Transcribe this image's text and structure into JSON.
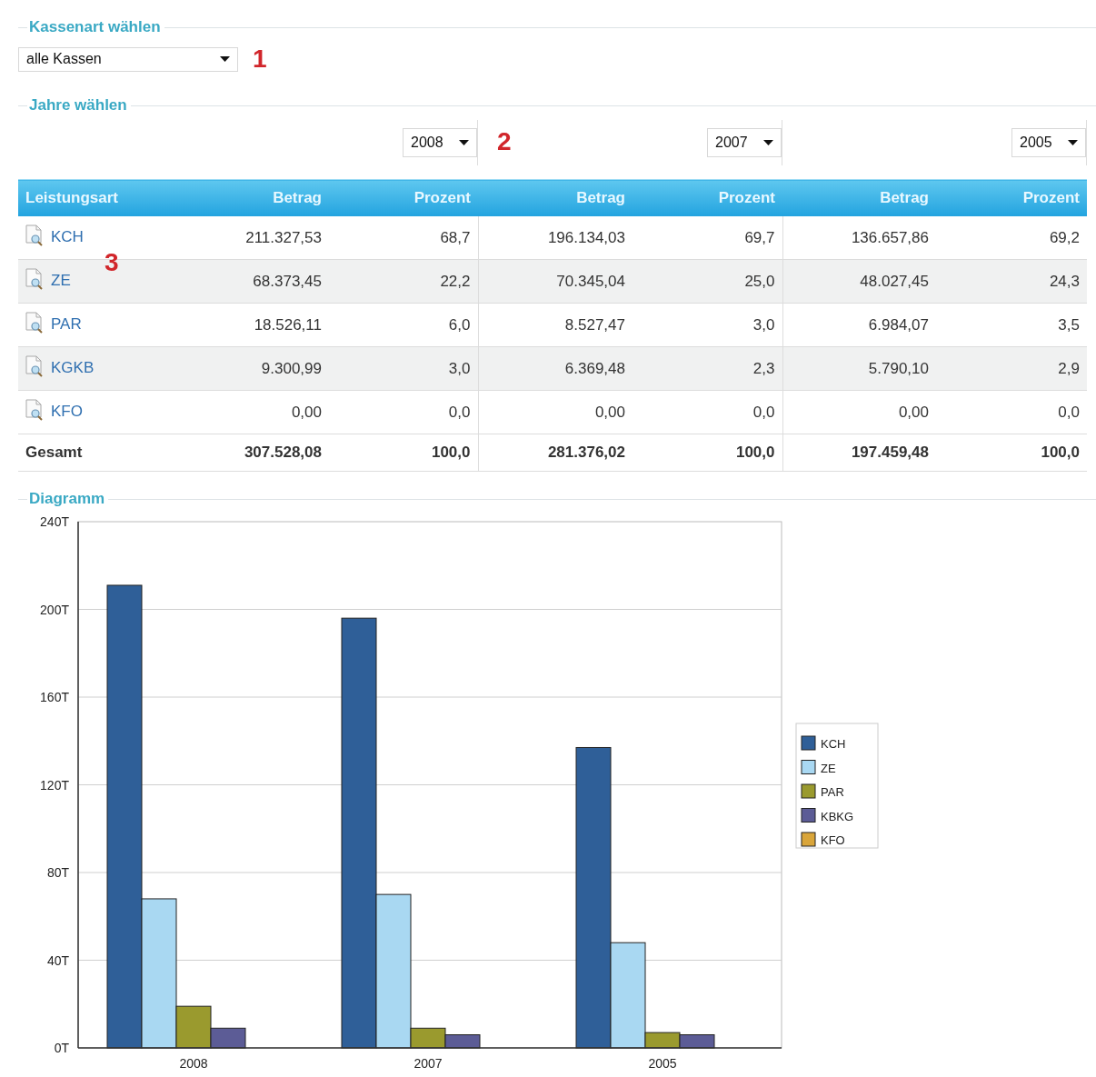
{
  "kassenart": {
    "heading": "Kassenart wählen",
    "value": "alle Kassen",
    "annotation": "1"
  },
  "jahre": {
    "heading": "Jahre wählen",
    "annotation": "2",
    "years": [
      {
        "value": "2008"
      },
      {
        "value": "2007"
      },
      {
        "value": "2005"
      }
    ]
  },
  "table": {
    "columns": [
      "Leistungsart",
      "Betrag",
      "Prozent",
      "Betrag",
      "Prozent",
      "Betrag",
      "Prozent"
    ],
    "annotation": "3",
    "rows": [
      {
        "cells": [
          "KCH",
          "211.327,53",
          "68,7",
          "196.134,03",
          "69,7",
          "136.657,86",
          "69,2"
        ]
      },
      {
        "cells": [
          "ZE",
          "68.373,45",
          "22,2",
          "70.345,04",
          "25,0",
          "48.027,45",
          "24,3"
        ]
      },
      {
        "cells": [
          "PAR",
          "18.526,11",
          "6,0",
          "8.527,47",
          "3,0",
          "6.984,07",
          "3,5"
        ]
      },
      {
        "cells": [
          "KGKB",
          "9.300,99",
          "3,0",
          "6.369,48",
          "2,3",
          "5.790,10",
          "2,9"
        ]
      },
      {
        "cells": [
          "KFO",
          "0,00",
          "0,0",
          "0,00",
          "0,0",
          "0,00",
          "0,0"
        ]
      }
    ],
    "total": {
      "cells": [
        "Gesamt",
        "307.528,08",
        "100,0",
        "281.376,02",
        "100,0",
        "197.459,48",
        "100,0"
      ]
    }
  },
  "diagramm": {
    "heading": "Diagramm",
    "chart_data": {
      "type": "bar",
      "categories": [
        "2008",
        "2007",
        "2005"
      ],
      "ylim": [
        0,
        240
      ],
      "grid": true,
      "legend": "right",
      "yticks": [
        {
          "value": 0,
          "label": "0T"
        },
        {
          "value": 40,
          "label": "40T"
        },
        {
          "value": 80,
          "label": "80T"
        },
        {
          "value": 120,
          "label": "120T"
        },
        {
          "value": 160,
          "label": "160T"
        },
        {
          "value": 200,
          "label": "200T"
        },
        {
          "value": 240,
          "label": "240T"
        }
      ],
      "series": [
        {
          "name": "KCH",
          "color": "#2f5f98",
          "values": [
            211,
            196,
            137
          ]
        },
        {
          "name": "ZE",
          "color": "#a9d8f2",
          "values": [
            68,
            70,
            48
          ]
        },
        {
          "name": "PAR",
          "color": "#9a9a2e",
          "values": [
            19,
            9,
            7
          ]
        },
        {
          "name": "KBKG",
          "color": "#5c5c96",
          "values": [
            9,
            6,
            6
          ]
        },
        {
          "name": "KFO",
          "color": "#d9a53a",
          "values": [
            0,
            0,
            0
          ]
        }
      ]
    }
  }
}
